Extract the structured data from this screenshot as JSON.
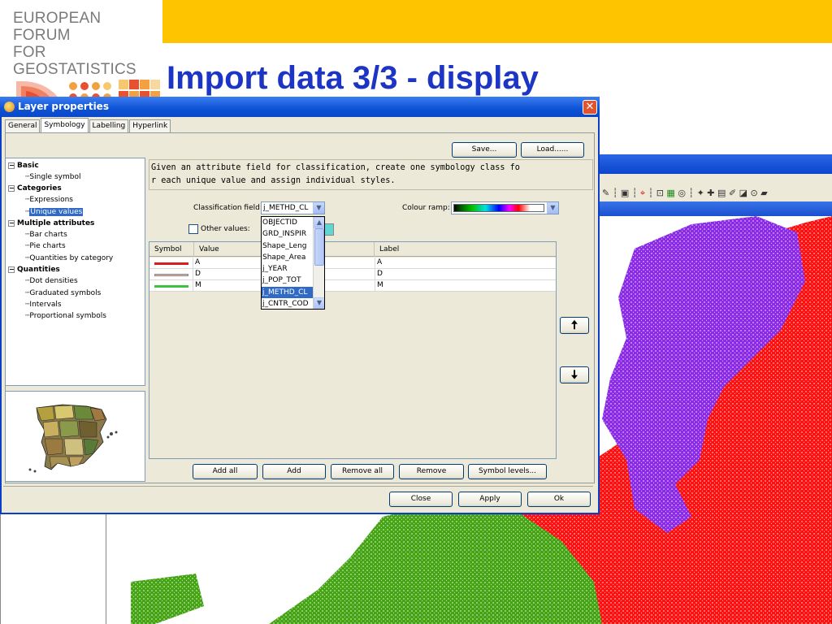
{
  "slide": {
    "logo_line1": "EUROPEAN FORUM",
    "logo_line2": "FOR GEOSTATISTICS",
    "title": "Import data 3/3 - display"
  },
  "background_app": {
    "toolbar_icons": [
      "edit-icon",
      "layer-icon",
      "crosshair-icon",
      "zoom-icon",
      "info-icon",
      "select-icon",
      "measure-icon",
      "settings-icon"
    ]
  },
  "colors": {
    "banner": "#ffc400",
    "title": "#1c35c4",
    "map_purple": "#8b2be8",
    "map_red": "#ff1010",
    "map_green": "#45a414",
    "dialog_title": "#0d52d6"
  },
  "dialog": {
    "title": "Layer properties",
    "close_label": "✕",
    "tabs": [
      {
        "label": "General"
      },
      {
        "label": "Symbology"
      },
      {
        "label": "Labelling"
      },
      {
        "label": "Hyperlink"
      }
    ],
    "save_label": "Save...",
    "load_label": "Load......",
    "tree": {
      "basic": "Basic",
      "single_symbol": "Single symbol",
      "categories": "Categories",
      "expressions": "Expressions",
      "unique_values": "Unique values",
      "multiple_attributes": "Multiple attributes",
      "bar_charts": "Bar charts",
      "pie_charts": "Pie charts",
      "quantities_by_category": "Quantities by category",
      "quantities": "Quantities",
      "dot_densities": "Dot densities",
      "graduated_symbols": "Graduated symbols",
      "intervals": "Intervals",
      "proportional_symbols": "Proportional symbols"
    },
    "description_line1": "Given an attribute field for classification, create one symbology class fo",
    "description_line2": "r each unique value and assign individual styles.",
    "classification_field_label": "Classification field:",
    "classification_field_value": "j_METHD_CL",
    "colour_ramp_label": "Colour ramp:",
    "other_values_label": "Other values:",
    "table": {
      "headers": {
        "symbol": "Symbol",
        "value": "Value",
        "label": "Label"
      },
      "rows": [
        {
          "value": "A",
          "label": "A",
          "color": "#d81e1e"
        },
        {
          "value": "D",
          "label": "D",
          "color": "#e8b4b4"
        },
        {
          "value": "M",
          "label": "M",
          "color": "#3cc43c"
        }
      ]
    },
    "dropdown_options": [
      "OBJECTID",
      "GRD_INSPIR",
      "Shape_Leng",
      "Shape_Area",
      "j_YEAR",
      "j_POP_TOT",
      "j_METHD_CL",
      "j_CNTR_COD"
    ],
    "dropdown_selected": "j_METHD_CL",
    "up_arrow": "🠅",
    "down_arrow": "🠇",
    "add_all_label": "Add all",
    "add_label": "Add",
    "remove_all_label": "Remove all",
    "remove_label": "Remove",
    "symbol_levels_label": "Symbol levels...",
    "close_button_label": "Close",
    "apply_label": "Apply",
    "ok_label": "Ok"
  }
}
